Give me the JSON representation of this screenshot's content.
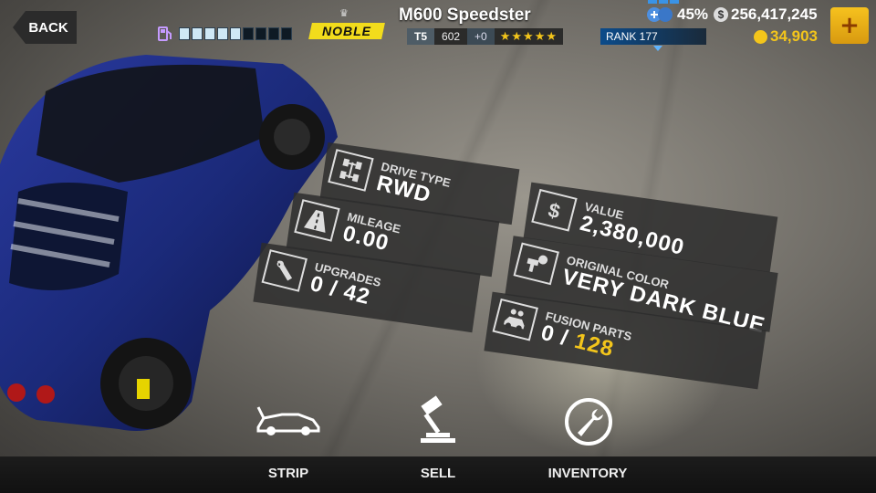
{
  "header": {
    "back_label": "BACK",
    "brand": "NOBLE",
    "car_name": "M600 Speedster",
    "tier": "T5",
    "pp": "602",
    "pp_bonus": "+0",
    "stars": "★★★★★",
    "rank": "RANK 177",
    "fuel_segments_filled": 5,
    "fuel_segments_total": 9
  },
  "currency": {
    "progress": "45%",
    "cash": "256,417,245",
    "gold": "34,903"
  },
  "stats": {
    "drive_type": {
      "label": "DRIVE TYPE",
      "value": "RWD"
    },
    "mileage": {
      "label": "MILEAGE",
      "value": "0.00"
    },
    "upgrades": {
      "label": "UPGRADES",
      "value": "0 / 42"
    },
    "value": {
      "label": "VALUE",
      "value": "2,380,000"
    },
    "original_color": {
      "label": "ORIGINAL COLOR",
      "value": "VERY DARK BLUE"
    },
    "fusion_parts": {
      "label": "FUSION PARTS",
      "value_prefix": "0 / ",
      "value_highlight": "128"
    }
  },
  "actions": {
    "strip": "STRIP",
    "sell": "SELL",
    "inventory": "INVENTORY"
  },
  "colors": {
    "accent_gold": "#f3c51b",
    "brand_yellow": "#f2dc1c",
    "car_blue": "#1b2a7a"
  }
}
